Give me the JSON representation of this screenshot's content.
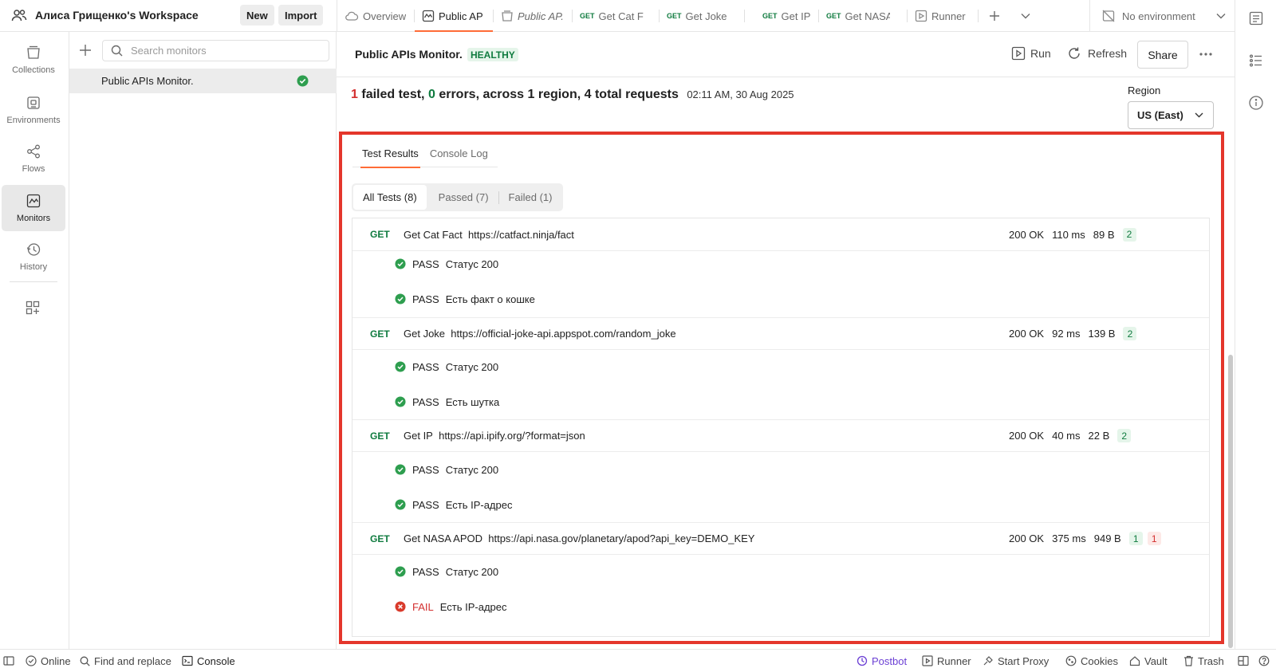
{
  "workspace": {
    "name": "Алиса Грищенко's Workspace",
    "new_label": "New",
    "import_label": "Import"
  },
  "tabs": [
    {
      "label": "Overview",
      "icon": "cloud-icon"
    },
    {
      "label": "Public AP",
      "icon": "monitor-icon"
    },
    {
      "label": "Public AP.",
      "icon": "collection-icon"
    },
    {
      "method": "GET",
      "label": "Get Cat F"
    },
    {
      "method": "GET",
      "label": "Get Joke"
    },
    {
      "method": "GET",
      "label": "Get IP"
    },
    {
      "method": "GET",
      "label": "Get NASA"
    },
    {
      "label": "Runner",
      "icon": "runner-icon"
    }
  ],
  "environment": {
    "label": "No environment"
  },
  "sidebar": {
    "items": [
      {
        "label": "Collections",
        "icon": "collections-icon"
      },
      {
        "label": "Environments",
        "icon": "environments-icon"
      },
      {
        "label": "Flows",
        "icon": "flows-icon"
      },
      {
        "label": "Monitors",
        "icon": "monitors-icon"
      },
      {
        "label": "History",
        "icon": "history-icon"
      }
    ]
  },
  "monitors_panel": {
    "search_placeholder": "Search monitors",
    "items": [
      {
        "label": "Public APIs Monitor.",
        "status": "healthy"
      }
    ]
  },
  "monitor": {
    "title": "Public APIs Monitor.",
    "status": "HEALTHY",
    "run_label": "Run",
    "refresh_label": "Refresh",
    "share_label": "Share"
  },
  "summary": {
    "failed_count": "1",
    "failed_text": "failed test,",
    "errors_count": "0",
    "rest_text": "errors, across 1 region, 4 total requests",
    "timestamp": "02:11 AM, 30 Aug 2025"
  },
  "region": {
    "label": "Region",
    "value": "US (East)"
  },
  "result_tabs": {
    "test_results": "Test Results",
    "console_log": "Console Log"
  },
  "filters": {
    "all": "All Tests (8)",
    "passed": "Passed (7)",
    "failed": "Failed (1)"
  },
  "requests": [
    {
      "method": "GET",
      "name": "Get Cat Fact",
      "url": "https://catfact.ninja/fact",
      "status": "200 OK",
      "time": "110 ms",
      "size": "89 B",
      "pass_count": "2",
      "fail_count": "",
      "tests": [
        {
          "result": "PASS",
          "name": "Статус 200"
        },
        {
          "result": "PASS",
          "name": "Есть факт о кошке"
        }
      ]
    },
    {
      "method": "GET",
      "name": "Get Joke",
      "url": "https://official-joke-api.appspot.com/random_joke",
      "status": "200 OK",
      "time": "92 ms",
      "size": "139 B",
      "pass_count": "2",
      "fail_count": "",
      "tests": [
        {
          "result": "PASS",
          "name": "Статус 200"
        },
        {
          "result": "PASS",
          "name": "Есть шутка"
        }
      ]
    },
    {
      "method": "GET",
      "name": "Get IP",
      "url": "https://api.ipify.org/?format=json",
      "status": "200 OK",
      "time": "40 ms",
      "size": "22 B",
      "pass_count": "2",
      "fail_count": "",
      "tests": [
        {
          "result": "PASS",
          "name": "Статус 200"
        },
        {
          "result": "PASS",
          "name": "Есть IP-адрес"
        }
      ]
    },
    {
      "method": "GET",
      "name": "Get NASA APOD",
      "url": "https://api.nasa.gov/planetary/apod?api_key=DEMO_KEY",
      "status": "200 OK",
      "time": "375 ms",
      "size": "949 B",
      "pass_count": "1",
      "fail_count": "1",
      "tests": [
        {
          "result": "PASS",
          "name": "Статус 200"
        },
        {
          "result": "FAIL",
          "name": "Есть IP-адрес"
        }
      ]
    }
  ],
  "statusbar": {
    "online": "Online",
    "find_replace": "Find and replace",
    "console": "Console",
    "postbot": "Postbot",
    "runner": "Runner",
    "start_proxy": "Start Proxy",
    "cookies": "Cookies",
    "vault": "Vault",
    "trash": "Trash"
  },
  "colors": {
    "accent": "#ff6c37",
    "pass": "#0f7b3f",
    "fail": "#d32f2f",
    "highlight_frame": "#e4362b"
  }
}
